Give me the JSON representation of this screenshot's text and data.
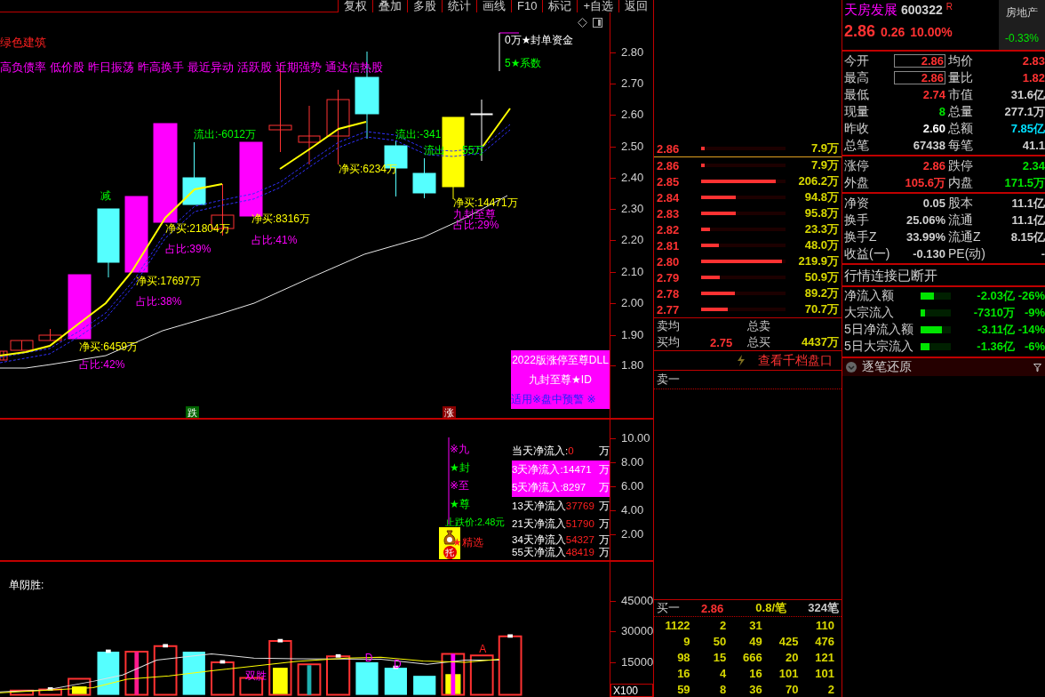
{
  "toolbar": [
    "复权",
    "叠加",
    "多股",
    "统计",
    "画线",
    "F10",
    "标记",
    "+自选",
    "返回"
  ],
  "chart": {
    "title": "绿色建筑",
    "tags": [
      "高负债率",
      "低价股",
      "昨日振荡",
      "昨高换手",
      "最近异动",
      "活跃股",
      "近期强势",
      "通达信热股"
    ],
    "legend": [
      {
        "text": "0万★封单资金",
        "kind": "white"
      },
      {
        "text": "5★系数",
        "kind": "green"
      }
    ],
    "labels": [
      {
        "text": "减",
        "kind": "green"
      },
      {
        "text": "流出:-6012万",
        "kind": "green"
      },
      {
        "text": "流出:-341",
        "kind": "green"
      },
      {
        "text": "流出",
        "kind": "green"
      },
      {
        "text": "55万",
        "kind": "green"
      },
      {
        "text": "净买:6234万",
        "kind": "yellow"
      },
      {
        "text": "净买:21804万",
        "kind": "yellow"
      },
      {
        "text": "占比:39%",
        "kind": "magenta"
      },
      {
        "text": "净买:8316万",
        "kind": "yellow"
      },
      {
        "text": "占比:41%",
        "kind": "magenta"
      },
      {
        "text": "净买:17697万",
        "kind": "yellow"
      },
      {
        "text": "占比:38%",
        "kind": "magenta"
      },
      {
        "text": "净买:6459万",
        "kind": "yellow"
      },
      {
        "text": "占比:42%",
        "kind": "magenta"
      },
      {
        "text": "净买:14471万",
        "kind": "yellow"
      },
      {
        "text": "九封至尊",
        "kind": "magenta"
      },
      {
        "text": "占比:29%",
        "kind": "magenta"
      }
    ],
    "promo": [
      "2022版涨停至尊DLL",
      "九封至尊★ID",
      "适用※盘中预警 ※"
    ],
    "markers": [
      {
        "text": "跌",
        "kind": "down"
      },
      {
        "text": "涨",
        "kind": "up"
      }
    ],
    "yticks": [
      "2.80",
      "2.70",
      "2.60",
      "2.50",
      "2.40",
      "2.30",
      "2.20",
      "2.10",
      "2.00",
      "1.90",
      "1.80"
    ]
  },
  "indicator": {
    "signals": [
      {
        "text": "※九",
        "kind": "magenta"
      },
      {
        "text": "★封",
        "kind": "green"
      },
      {
        "text": "※至",
        "kind": "magenta"
      },
      {
        "text": "★尊",
        "kind": "green"
      }
    ],
    "stop_price": "止跌价:2.48元",
    "badge": "托",
    "pick": "★精选",
    "flows": [
      {
        "label": "当天净流入:",
        "value": "0",
        "unit": "万",
        "highlighted": false
      },
      {
        "label": "3天净流入: ",
        "value": "14471",
        "unit": "万",
        "highlighted": true
      },
      {
        "label": "5天净流入: ",
        "value": "8297 ",
        "unit": "万",
        "highlighted": true
      },
      {
        "label": "13天净流入",
        "value": "37769",
        "unit": "万",
        "highlighted": false
      },
      {
        "label": "21天净流入",
        "value": "51790",
        "unit": "万",
        "highlighted": false
      },
      {
        "label": "34天净流入",
        "value": "54327",
        "unit": "万",
        "highlighted": false
      },
      {
        "label": "55天净流入",
        "value": "48419",
        "unit": "万",
        "highlighted": false
      }
    ],
    "yticks": [
      "10.00",
      "8.00",
      "6.00",
      "4.00",
      "2.00"
    ]
  },
  "volume": {
    "title": "单阴胜:",
    "labels": [
      {
        "text": "双胜",
        "kind": "magenta"
      },
      {
        "text": "D",
        "kind": "magenta"
      },
      {
        "text": "D",
        "kind": "magenta"
      },
      {
        "text": "A",
        "kind": "red"
      }
    ],
    "yticks": [
      "45000",
      "30000",
      "15000"
    ],
    "unit": "X100"
  },
  "order_book": {
    "asks": [
      {
        "price": "2.86",
        "level": 0.04,
        "volume": "7.9万"
      }
    ],
    "bids": [
      {
        "price": "2.86",
        "level": 0.04,
        "volume": "7.9万"
      },
      {
        "price": "2.85",
        "level": 0.88,
        "volume": "206.2万"
      },
      {
        "price": "2.84",
        "level": 0.41,
        "volume": "94.8万"
      },
      {
        "price": "2.83",
        "level": 0.41,
        "volume": "95.8万"
      },
      {
        "price": "2.82",
        "level": 0.11,
        "volume": "23.3万"
      },
      {
        "price": "2.81",
        "level": 0.21,
        "volume": "48.0万"
      },
      {
        "price": "2.80",
        "level": 0.96,
        "volume": "219.9万"
      },
      {
        "price": "2.79",
        "level": 0.22,
        "volume": "50.9万"
      },
      {
        "price": "2.78",
        "level": 0.4,
        "volume": "89.2万"
      },
      {
        "price": "2.77",
        "level": 0.32,
        "volume": "70.7万"
      }
    ],
    "sell_avg_label": "卖均",
    "sell_total_label": "总卖",
    "buy_avg_label": "买均",
    "buy_avg": "2.75",
    "buy_total_label": "总买",
    "buy_total": "4437万",
    "thousand_link": "查看千档盘口",
    "ask_label": "卖一",
    "bid": {
      "label": "买一",
      "price": "2.86",
      "avg": "0.8/笔",
      "count": "324笔"
    },
    "queue": [
      [
        "1122",
        "2",
        "31",
        "110"
      ],
      [
        "9",
        "50",
        "49",
        "425",
        "476"
      ],
      [
        "98",
        "15",
        "666",
        "20",
        "121"
      ],
      [
        "16",
        "4",
        "16",
        "101",
        "101"
      ],
      [
        "59",
        "8",
        "36",
        "70",
        "2"
      ]
    ]
  },
  "quote": {
    "name": "天房发展",
    "code": "600322",
    "flag": "R",
    "price": "2.86",
    "change": "0.26",
    "change_pct": "10.00%",
    "sector": {
      "name": "房地产",
      "change": "-0.33%"
    },
    "groups": [
      [
        [
          {
            "label": "今开",
            "value": "2.86",
            "kind": "up",
            "boxed": true
          },
          {
            "label": "均价",
            "value": "2.83",
            "kind": "up",
            "boxed": false
          }
        ],
        [
          {
            "label": "最高",
            "value": "2.86",
            "kind": "up",
            "boxed": true
          },
          {
            "label": "量比",
            "value": "1.82",
            "kind": "up",
            "boxed": false
          }
        ],
        [
          {
            "label": "最低",
            "value": "2.74",
            "kind": "up",
            "boxed": false
          },
          {
            "label": "市值",
            "value": "31.6亿",
            "kind": "flat",
            "boxed": false
          }
        ],
        [
          {
            "label": "现量",
            "value": "8",
            "kind": "down",
            "boxed": false
          },
          {
            "label": "总量",
            "value": "277.1万",
            "kind": "flat",
            "boxed": false
          }
        ],
        [
          {
            "label": "昨收",
            "value": "2.60",
            "kind": "white",
            "boxed": false
          },
          {
            "label": "总额",
            "value": "7.85亿",
            "kind": "cyan",
            "boxed": false
          }
        ],
        [
          {
            "label": "总笔",
            "value": "67438",
            "kind": "flat",
            "boxed": false
          },
          {
            "label": "每笔",
            "value": "41.1",
            "kind": "flat",
            "boxed": false
          }
        ]
      ],
      [
        [
          {
            "label": "涨停",
            "value": "2.86",
            "kind": "up",
            "boxed": false
          },
          {
            "label": "跌停",
            "value": "2.34",
            "kind": "down",
            "boxed": false
          }
        ],
        [
          {
            "label": "外盘",
            "value": "105.6万",
            "kind": "up",
            "boxed": false
          },
          {
            "label": "内盘",
            "value": "171.5万",
            "kind": "down",
            "boxed": false
          }
        ]
      ],
      [
        [
          {
            "label": "净资",
            "value": "0.05",
            "kind": "flat",
            "boxed": false
          },
          {
            "label": "股本",
            "value": "11.1亿",
            "kind": "flat",
            "boxed": false
          }
        ],
        [
          {
            "label": "换手",
            "value": "25.06%",
            "kind": "flat",
            "boxed": false
          },
          {
            "label": "流通",
            "value": "11.1亿",
            "kind": "flat",
            "boxed": false
          }
        ],
        [
          {
            "label": "换手Z",
            "value": "33.99%",
            "kind": "flat",
            "boxed": false
          },
          {
            "label": "流通Z",
            "value": "8.15亿",
            "kind": "flat",
            "boxed": false
          }
        ],
        [
          {
            "label": "收益(一)",
            "value": "-0.130",
            "kind": "flat",
            "boxed": false
          },
          {
            "label": "PE(动)",
            "value": "-",
            "kind": "flat",
            "boxed": false
          }
        ]
      ]
    ],
    "status": "行情连接已断开",
    "flows": [
      {
        "label": "净流入额",
        "level": 0.45,
        "value": "-2.03亿",
        "pct": "-26%"
      },
      {
        "label": "大宗流入",
        "level": 0.15,
        "value": "-7310万",
        "pct": "-9%"
      },
      {
        "label": "5日净流入额",
        "level": 0.7,
        "value": "-3.11亿",
        "pct": "-14%"
      },
      {
        "label": "5日大宗流入",
        "level": 0.3,
        "value": "-1.36亿",
        "pct": "-6%"
      }
    ],
    "ticks_header": "逐笔还原"
  }
}
